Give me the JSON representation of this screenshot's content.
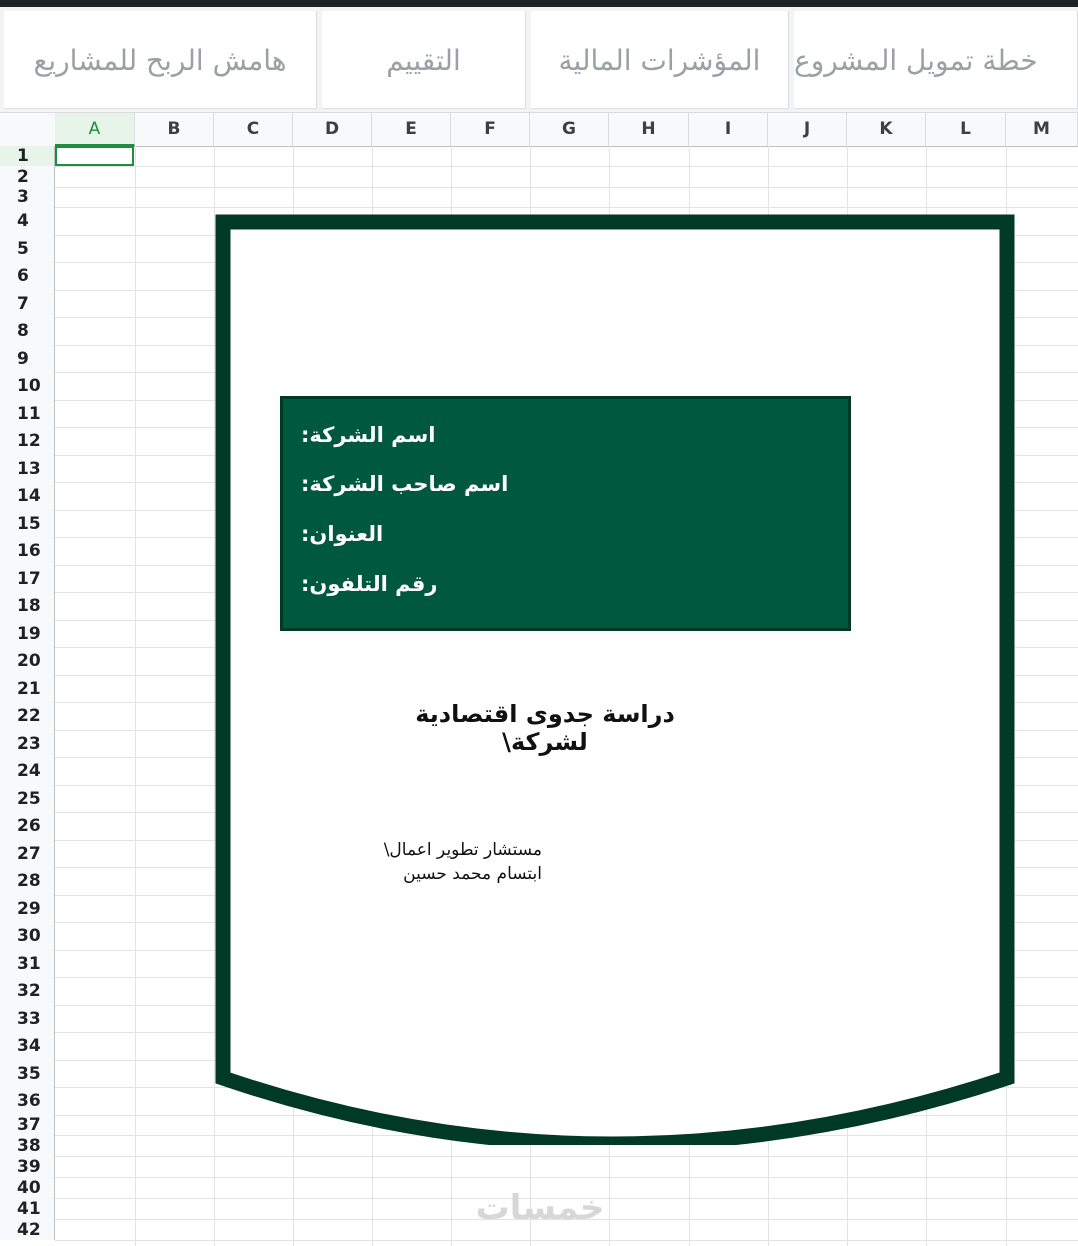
{
  "tabs": [
    {
      "label": "هامش الربح للمشاريع"
    },
    {
      "label": "التقييم"
    },
    {
      "label": "المؤشرات المالية"
    },
    {
      "label": "خطة تمويل المشروع"
    }
  ],
  "columns": [
    "A",
    "B",
    "C",
    "D",
    "E",
    "F",
    "G",
    "H",
    "I",
    "J",
    "K",
    "L",
    "M"
  ],
  "active_column": "A",
  "active_row": "1",
  "rows": [
    "1",
    "2",
    "3",
    "4",
    "5",
    "6",
    "7",
    "8",
    "9",
    "10",
    "11",
    "12",
    "13",
    "14",
    "15",
    "16",
    "17",
    "18",
    "19",
    "20",
    "21",
    "22",
    "23",
    "24",
    "25",
    "26",
    "27",
    "28",
    "29",
    "30",
    "31",
    "32",
    "33",
    "34",
    "35",
    "36",
    "37",
    "38",
    "39",
    "40",
    "41",
    "42"
  ],
  "cover": {
    "info": {
      "company_name": "اسم الشركة:",
      "owner_name": "اسم صاحب الشركة:",
      "address": "العنوان:",
      "phone": "رقم التلفون:"
    },
    "study_title": "دراسة جدوى اقتصادية لشركة\\",
    "consultant_title": "مستشار تطوير اعمال\\",
    "consultant_name": "ابتسام محمد حسين"
  },
  "colors": {
    "frame": "#003a26",
    "info_box": "#00583d",
    "selection": "#1e8e3e"
  },
  "watermark": "خمسات"
}
